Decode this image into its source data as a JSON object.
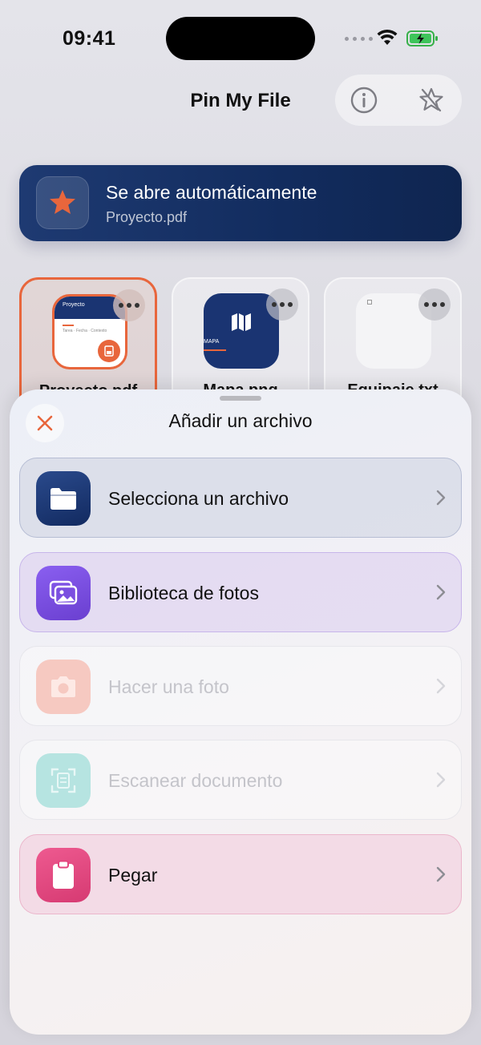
{
  "status": {
    "time": "09:41"
  },
  "header": {
    "title": "Pin My File",
    "info_icon": "info-icon",
    "favorite_icon": "star-sparkle-icon"
  },
  "banner": {
    "title": "Se abre automáticamente",
    "subtitle": "Proyecto.pdf",
    "icon": "star-icon",
    "accent": "#e8663c"
  },
  "files": [
    {
      "name": "Proyecto.pdf",
      "thumb_title": "Proyecto",
      "thumb_text": "Tarea · Fecha · Contexto",
      "selected": true
    },
    {
      "name": "Mapa.png",
      "thumb_title": "MAPA",
      "selected": false
    },
    {
      "name": "Equipaje.txt",
      "selected": false
    }
  ],
  "sheet": {
    "title": "Añadir un archivo",
    "close_icon": "close-icon",
    "options": [
      {
        "label": "Selecciona un archivo",
        "icon": "folder-icon",
        "color": "#1a3472",
        "enabled": true
      },
      {
        "label": "Biblioteca de fotos",
        "icon": "photos-icon",
        "color": "#7b4fe0",
        "enabled": true
      },
      {
        "label": "Hacer una foto",
        "icon": "camera-icon",
        "color": "#f3b3a9",
        "enabled": false
      },
      {
        "label": "Escanear documento",
        "icon": "scan-document-icon",
        "color": "#a7dedb",
        "enabled": false
      },
      {
        "label": "Pegar",
        "icon": "clipboard-icon",
        "color": "#e4457e",
        "enabled": true
      }
    ]
  }
}
